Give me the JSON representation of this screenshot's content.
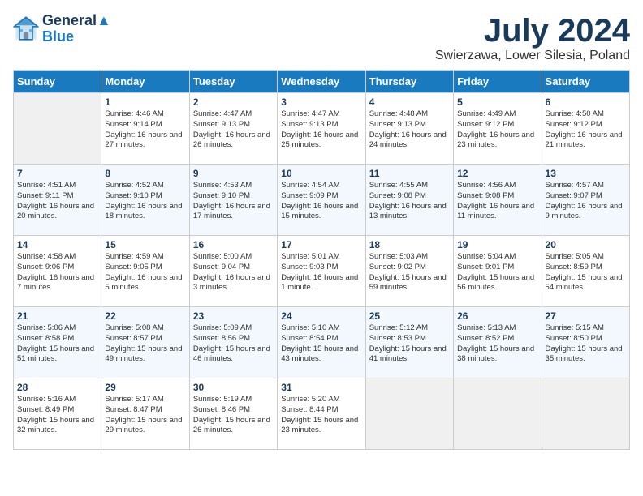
{
  "header": {
    "logo_line1": "General",
    "logo_line2": "Blue",
    "month": "July 2024",
    "location": "Swierzawa, Lower Silesia, Poland"
  },
  "weekdays": [
    "Sunday",
    "Monday",
    "Tuesday",
    "Wednesday",
    "Thursday",
    "Friday",
    "Saturday"
  ],
  "weeks": [
    [
      {
        "day": "",
        "sunrise": "",
        "sunset": "",
        "daylight": ""
      },
      {
        "day": "1",
        "sunrise": "Sunrise: 4:46 AM",
        "sunset": "Sunset: 9:14 PM",
        "daylight": "Daylight: 16 hours and 27 minutes."
      },
      {
        "day": "2",
        "sunrise": "Sunrise: 4:47 AM",
        "sunset": "Sunset: 9:13 PM",
        "daylight": "Daylight: 16 hours and 26 minutes."
      },
      {
        "day": "3",
        "sunrise": "Sunrise: 4:47 AM",
        "sunset": "Sunset: 9:13 PM",
        "daylight": "Daylight: 16 hours and 25 minutes."
      },
      {
        "day": "4",
        "sunrise": "Sunrise: 4:48 AM",
        "sunset": "Sunset: 9:13 PM",
        "daylight": "Daylight: 16 hours and 24 minutes."
      },
      {
        "day": "5",
        "sunrise": "Sunrise: 4:49 AM",
        "sunset": "Sunset: 9:12 PM",
        "daylight": "Daylight: 16 hours and 23 minutes."
      },
      {
        "day": "6",
        "sunrise": "Sunrise: 4:50 AM",
        "sunset": "Sunset: 9:12 PM",
        "daylight": "Daylight: 16 hours and 21 minutes."
      }
    ],
    [
      {
        "day": "7",
        "sunrise": "Sunrise: 4:51 AM",
        "sunset": "Sunset: 9:11 PM",
        "daylight": "Daylight: 16 hours and 20 minutes."
      },
      {
        "day": "8",
        "sunrise": "Sunrise: 4:52 AM",
        "sunset": "Sunset: 9:10 PM",
        "daylight": "Daylight: 16 hours and 18 minutes."
      },
      {
        "day": "9",
        "sunrise": "Sunrise: 4:53 AM",
        "sunset": "Sunset: 9:10 PM",
        "daylight": "Daylight: 16 hours and 17 minutes."
      },
      {
        "day": "10",
        "sunrise": "Sunrise: 4:54 AM",
        "sunset": "Sunset: 9:09 PM",
        "daylight": "Daylight: 16 hours and 15 minutes."
      },
      {
        "day": "11",
        "sunrise": "Sunrise: 4:55 AM",
        "sunset": "Sunset: 9:08 PM",
        "daylight": "Daylight: 16 hours and 13 minutes."
      },
      {
        "day": "12",
        "sunrise": "Sunrise: 4:56 AM",
        "sunset": "Sunset: 9:08 PM",
        "daylight": "Daylight: 16 hours and 11 minutes."
      },
      {
        "day": "13",
        "sunrise": "Sunrise: 4:57 AM",
        "sunset": "Sunset: 9:07 PM",
        "daylight": "Daylight: 16 hours and 9 minutes."
      }
    ],
    [
      {
        "day": "14",
        "sunrise": "Sunrise: 4:58 AM",
        "sunset": "Sunset: 9:06 PM",
        "daylight": "Daylight: 16 hours and 7 minutes."
      },
      {
        "day": "15",
        "sunrise": "Sunrise: 4:59 AM",
        "sunset": "Sunset: 9:05 PM",
        "daylight": "Daylight: 16 hours and 5 minutes."
      },
      {
        "day": "16",
        "sunrise": "Sunrise: 5:00 AM",
        "sunset": "Sunset: 9:04 PM",
        "daylight": "Daylight: 16 hours and 3 minutes."
      },
      {
        "day": "17",
        "sunrise": "Sunrise: 5:01 AM",
        "sunset": "Sunset: 9:03 PM",
        "daylight": "Daylight: 16 hours and 1 minute."
      },
      {
        "day": "18",
        "sunrise": "Sunrise: 5:03 AM",
        "sunset": "Sunset: 9:02 PM",
        "daylight": "Daylight: 15 hours and 59 minutes."
      },
      {
        "day": "19",
        "sunrise": "Sunrise: 5:04 AM",
        "sunset": "Sunset: 9:01 PM",
        "daylight": "Daylight: 15 hours and 56 minutes."
      },
      {
        "day": "20",
        "sunrise": "Sunrise: 5:05 AM",
        "sunset": "Sunset: 8:59 PM",
        "daylight": "Daylight: 15 hours and 54 minutes."
      }
    ],
    [
      {
        "day": "21",
        "sunrise": "Sunrise: 5:06 AM",
        "sunset": "Sunset: 8:58 PM",
        "daylight": "Daylight: 15 hours and 51 minutes."
      },
      {
        "day": "22",
        "sunrise": "Sunrise: 5:08 AM",
        "sunset": "Sunset: 8:57 PM",
        "daylight": "Daylight: 15 hours and 49 minutes."
      },
      {
        "day": "23",
        "sunrise": "Sunrise: 5:09 AM",
        "sunset": "Sunset: 8:56 PM",
        "daylight": "Daylight: 15 hours and 46 minutes."
      },
      {
        "day": "24",
        "sunrise": "Sunrise: 5:10 AM",
        "sunset": "Sunset: 8:54 PM",
        "daylight": "Daylight: 15 hours and 43 minutes."
      },
      {
        "day": "25",
        "sunrise": "Sunrise: 5:12 AM",
        "sunset": "Sunset: 8:53 PM",
        "daylight": "Daylight: 15 hours and 41 minutes."
      },
      {
        "day": "26",
        "sunrise": "Sunrise: 5:13 AM",
        "sunset": "Sunset: 8:52 PM",
        "daylight": "Daylight: 15 hours and 38 minutes."
      },
      {
        "day": "27",
        "sunrise": "Sunrise: 5:15 AM",
        "sunset": "Sunset: 8:50 PM",
        "daylight": "Daylight: 15 hours and 35 minutes."
      }
    ],
    [
      {
        "day": "28",
        "sunrise": "Sunrise: 5:16 AM",
        "sunset": "Sunset: 8:49 PM",
        "daylight": "Daylight: 15 hours and 32 minutes."
      },
      {
        "day": "29",
        "sunrise": "Sunrise: 5:17 AM",
        "sunset": "Sunset: 8:47 PM",
        "daylight": "Daylight: 15 hours and 29 minutes."
      },
      {
        "day": "30",
        "sunrise": "Sunrise: 5:19 AM",
        "sunset": "Sunset: 8:46 PM",
        "daylight": "Daylight: 15 hours and 26 minutes."
      },
      {
        "day": "31",
        "sunrise": "Sunrise: 5:20 AM",
        "sunset": "Sunset: 8:44 PM",
        "daylight": "Daylight: 15 hours and 23 minutes."
      },
      {
        "day": "",
        "sunrise": "",
        "sunset": "",
        "daylight": ""
      },
      {
        "day": "",
        "sunrise": "",
        "sunset": "",
        "daylight": ""
      },
      {
        "day": "",
        "sunrise": "",
        "sunset": "",
        "daylight": ""
      }
    ]
  ]
}
